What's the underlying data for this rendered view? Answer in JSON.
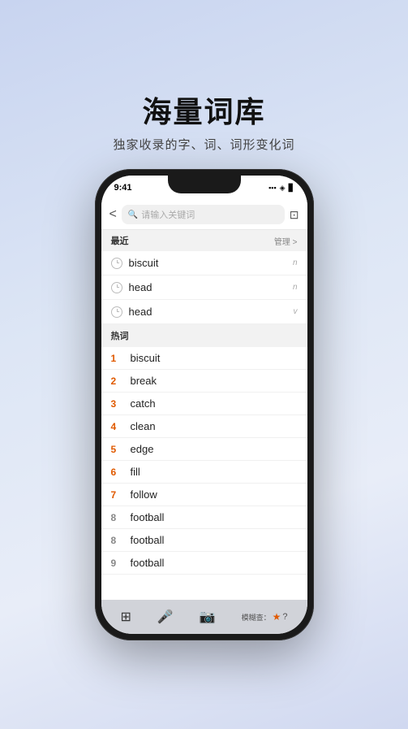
{
  "header": {
    "title": "海量词库",
    "subtitle": "独家收录的字、词、词形变化词"
  },
  "status_bar": {
    "time": "9:41",
    "signal": "▪▪▪",
    "wifi": "WiFi",
    "battery": "🔋"
  },
  "search": {
    "placeholder": "请输入关键词",
    "back_label": "<",
    "camera_label": "📷"
  },
  "recent_section": {
    "label": "最近",
    "manage_label": "管理 >"
  },
  "recent_items": [
    {
      "word": "biscuit",
      "type": "n"
    },
    {
      "word": "head",
      "type": "n"
    },
    {
      "word": "head",
      "type": "v"
    }
  ],
  "hot_section": {
    "label": "热词"
  },
  "hot_items": [
    {
      "rank": "1",
      "word": "biscuit",
      "highlight": true
    },
    {
      "rank": "2",
      "word": "break",
      "highlight": true
    },
    {
      "rank": "3",
      "word": "catch",
      "highlight": true
    },
    {
      "rank": "4",
      "word": "clean",
      "highlight": true
    },
    {
      "rank": "5",
      "word": "edge",
      "highlight": true
    },
    {
      "rank": "6",
      "word": "fill",
      "highlight": true
    },
    {
      "rank": "7",
      "word": "follow",
      "highlight": true
    },
    {
      "rank": "8",
      "word": "football",
      "highlight": false
    },
    {
      "rank": "8",
      "word": "football",
      "highlight": false
    },
    {
      "rank": "9",
      "word": "football",
      "highlight": false
    }
  ],
  "keyboard": {
    "grid_label": "⊞",
    "mic_label": "🎤",
    "camera_label": "📷",
    "lookup_label": "模糊查：",
    "star_label": "★",
    "help_label": "?"
  }
}
